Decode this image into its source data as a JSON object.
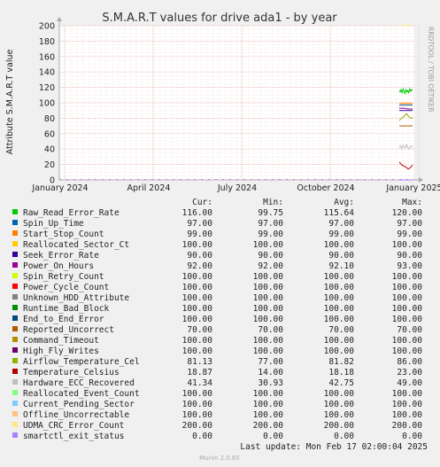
{
  "chart_data": {
    "type": "line",
    "title": "S.M.A.R.T values for drive ada1 - by year",
    "ylabel": "Attribute S.M.A.R.T value",
    "xlabel": "",
    "ylim": [
      0,
      200
    ],
    "yticks": [
      "0",
      "20",
      "40",
      "60",
      "80",
      "100",
      "120",
      "140",
      "160",
      "180",
      "200"
    ],
    "xticks": [
      "January 2024",
      "April 2024",
      "July 2024",
      "October 2024",
      "January 2025"
    ],
    "grid": true,
    "side_label": "RRDTOOL / TOBI OETIKER",
    "columns": [
      "Cur:",
      "Min:",
      "Avg:",
      "Max:"
    ],
    "series": [
      {
        "name": "Raw_Read_Error_Rate",
        "color": "#00cc00",
        "cur": "116.00",
        "min": "99.75",
        "avg": "115.64",
        "max": "120.00",
        "values": [
          116,
          114,
          117,
          113,
          118,
          115,
          112,
          117,
          114,
          116,
          113,
          118,
          115,
          117,
          116
        ]
      },
      {
        "name": "Spin_Up_Time",
        "color": "#0066b3",
        "cur": "97.00",
        "min": "97.00",
        "avg": "97.00",
        "max": "97.00",
        "values": [
          97,
          97
        ]
      },
      {
        "name": "Start_Stop_Count",
        "color": "#ff8000",
        "cur": "99.00",
        "min": "99.00",
        "avg": "99.00",
        "max": "99.00",
        "values": [
          99,
          99
        ]
      },
      {
        "name": "Reallocated_Sector_Ct",
        "color": "#ffcc00",
        "cur": "100.00",
        "min": "100.00",
        "avg": "100.00",
        "max": "100.00",
        "values": [
          100,
          100
        ]
      },
      {
        "name": "Seek_Error_Rate",
        "color": "#330099",
        "cur": "90.00",
        "min": "90.00",
        "avg": "90.00",
        "max": "90.00",
        "values": [
          90,
          90
        ]
      },
      {
        "name": "Power_On_Hours",
        "color": "#990099",
        "cur": "92.00",
        "min": "92.00",
        "avg": "92.10",
        "max": "93.00",
        "values": [
          93,
          93,
          92,
          92
        ]
      },
      {
        "name": "Spin_Retry_Count",
        "color": "#ccff00",
        "cur": "100.00",
        "min": "100.00",
        "avg": "100.00",
        "max": "100.00",
        "values": [
          100,
          100
        ]
      },
      {
        "name": "Power_Cycle_Count",
        "color": "#ff0000",
        "cur": "100.00",
        "min": "100.00",
        "avg": "100.00",
        "max": "100.00",
        "values": [
          100,
          100
        ]
      },
      {
        "name": "Unknown_HDD_Attribute",
        "color": "#808080",
        "cur": "100.00",
        "min": "100.00",
        "avg": "100.00",
        "max": "100.00",
        "values": [
          100,
          100
        ]
      },
      {
        "name": "Runtime_Bad_Block",
        "color": "#008f00",
        "cur": "100.00",
        "min": "100.00",
        "avg": "100.00",
        "max": "100.00",
        "values": [
          100,
          100
        ]
      },
      {
        "name": "End_to_End_Error",
        "color": "#00487d",
        "cur": "100.00",
        "min": "100.00",
        "avg": "100.00",
        "max": "100.00",
        "values": [
          100,
          100
        ]
      },
      {
        "name": "Reported_Uncorrect",
        "color": "#b35a00",
        "cur": "70.00",
        "min": "70.00",
        "avg": "70.00",
        "max": "70.00",
        "values": [
          70,
          70
        ]
      },
      {
        "name": "Command_Timeout",
        "color": "#b38f00",
        "cur": "100.00",
        "min": "100.00",
        "avg": "100.00",
        "max": "100.00",
        "values": [
          100,
          100
        ]
      },
      {
        "name": "High_Fly_Writes",
        "color": "#6b006b",
        "cur": "100.00",
        "min": "100.00",
        "avg": "100.00",
        "max": "100.00",
        "values": [
          100,
          100
        ]
      },
      {
        "name": "Airflow_Temperature_Cel",
        "color": "#8fb300",
        "cur": "81.13",
        "min": "77.00",
        "avg": "81.82",
        "max": "86.00",
        "values": [
          77,
          79,
          81,
          82,
          84,
          86,
          83,
          81,
          80,
          81
        ]
      },
      {
        "name": "Temperature_Celsius",
        "color": "#b30000",
        "cur": "18.87",
        "min": "14.00",
        "avg": "18.18",
        "max": "23.00",
        "values": [
          23,
          21,
          19,
          18,
          17,
          16,
          14,
          15,
          17,
          19
        ]
      },
      {
        "name": "Hardware_ECC_Recovered",
        "color": "#bebebe",
        "cur": "41.34",
        "min": "30.93",
        "avg": "42.75",
        "max": "49.00",
        "values": [
          42,
          44,
          40,
          45,
          43,
          41,
          46,
          42,
          40,
          43,
          44,
          41
        ]
      },
      {
        "name": "Reallocated_Event_Count",
        "color": "#80ff80",
        "cur": "100.00",
        "min": "100.00",
        "avg": "100.00",
        "max": "100.00",
        "values": [
          100,
          100
        ]
      },
      {
        "name": "Current_Pending_Sector",
        "color": "#80c9ff",
        "cur": "100.00",
        "min": "100.00",
        "avg": "100.00",
        "max": "100.00",
        "values": [
          100,
          100
        ]
      },
      {
        "name": "Offline_Uncorrectable",
        "color": "#ffc080",
        "cur": "100.00",
        "min": "100.00",
        "avg": "100.00",
        "max": "100.00",
        "values": [
          100,
          100
        ]
      },
      {
        "name": "UDMA_CRC_Error_Count",
        "color": "#ffe680",
        "cur": "200.00",
        "min": "200.00",
        "avg": "200.00",
        "max": "200.00",
        "values": [
          200,
          200
        ]
      },
      {
        "name": "smartctl_exit_status",
        "color": "#aa80ff",
        "cur": "0.00",
        "min": "0.00",
        "avg": "0.00",
        "max": "0.00",
        "values": [
          0,
          0
        ]
      }
    ],
    "last_update": "Last update: Mon Feb 17 02:00:04 2025",
    "footer": "Munin 2.0.65"
  }
}
